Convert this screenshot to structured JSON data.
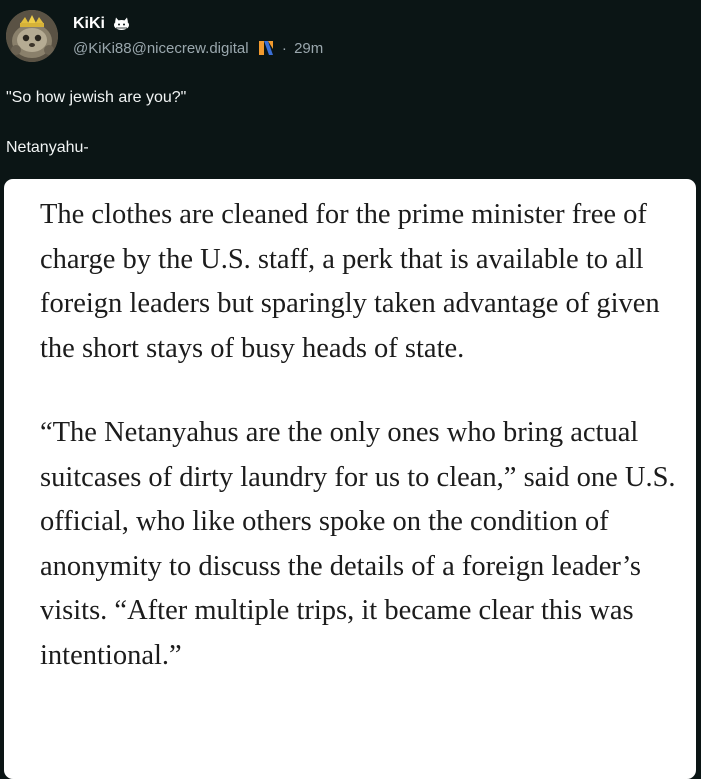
{
  "author": {
    "display_name": "KiKi",
    "name_emoji": "cat-emoji",
    "handle": "@KiKi88@nicecrew.digital",
    "instance_icon": "instance-logo-icon",
    "separator": "·",
    "time": "29m"
  },
  "post": {
    "text_lines": [
      "\"So how jewish are you?\"",
      "Netanyahu-"
    ]
  },
  "media": {
    "paragraphs": [
      "The clothes are cleaned for the prime minister free of charge by the U.S. staff, a perk that is available to all foreign leaders but sparingly taken advantage of given the short stays of busy heads of state.",
      "“The Netanyahus are the only ones who bring actual suitcases of dirty laundry for us to clean,” said one U.S. official, who like others spoke on the condition of anonymity to discuss the details of a foreign leader’s visits. “After multiple trips, it became clear this was intentional.”"
    ]
  },
  "colors": {
    "background": "#0b1515",
    "text": "#f1f4f4",
    "muted": "#9aa7ad",
    "media_bg": "#ffffff",
    "article_text": "#1c1c1c",
    "instance_icon_orange": "#f29a2e",
    "instance_icon_blue": "#3b6fd6"
  }
}
